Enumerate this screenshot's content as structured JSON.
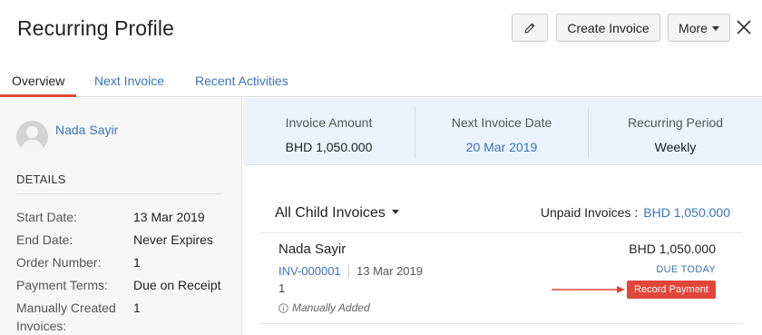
{
  "header": {
    "title": "Recurring Profile",
    "edit_icon": "pencil-icon",
    "create_invoice_label": "Create Invoice",
    "more_label": "More",
    "close_icon": "close-icon"
  },
  "tabs": [
    {
      "label": "Overview",
      "active": true
    },
    {
      "label": "Next Invoice",
      "active": false
    },
    {
      "label": "Recent Activities",
      "active": false
    }
  ],
  "sidebar": {
    "customer_name": "Nada Sayir",
    "details_heading": "DETAILS",
    "details": [
      {
        "label": "Start Date:",
        "value": "13 Mar 2019"
      },
      {
        "label": "End Date:",
        "value": "Never Expires"
      },
      {
        "label": "Order Number:",
        "value": "1"
      },
      {
        "label": "Payment Terms:",
        "value": "Due on Receipt"
      },
      {
        "label": "Manually Created Invoices:",
        "value": "1"
      }
    ]
  },
  "summary": {
    "invoice_amount_label": "Invoice Amount",
    "invoice_amount_value": "BHD 1,050.000",
    "next_invoice_date_label": "Next Invoice Date",
    "next_invoice_date_value": "20 Mar 2019",
    "recurring_period_label": "Recurring Period",
    "recurring_period_value": "Weekly"
  },
  "child_invoices": {
    "filter_label": "All Child Invoices",
    "unpaid_label": "Unpaid Invoices :",
    "unpaid_amount": "BHD 1,050.000",
    "items": [
      {
        "customer": "Nada Sayir",
        "number": "INV-000001",
        "date": "13 Mar 2019",
        "count": "1",
        "note": "Manually Added",
        "amount": "BHD 1,050.000",
        "status": "DUE TODAY",
        "action_label": "Record Payment"
      }
    ]
  },
  "colors": {
    "accent_blue": "#3a73b8",
    "accent_red": "#e0463a",
    "summary_bg": "#eaf3fb",
    "sidebar_bg": "#f7f7f7"
  }
}
